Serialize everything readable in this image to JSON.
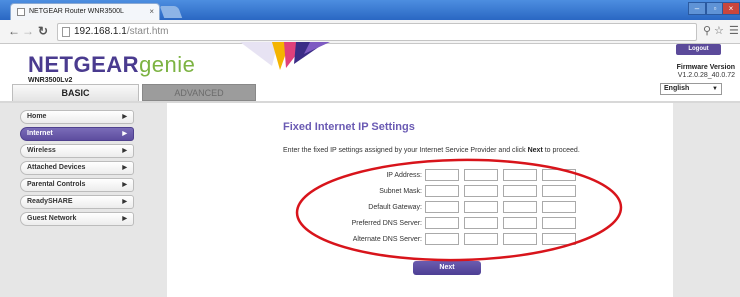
{
  "browser": {
    "tab_title": "NETGEAR Router WNR3500L",
    "tab_close": "×",
    "url_host": "192.168.1.1",
    "url_path": "/start.htm",
    "win_min": "–",
    "win_max": "▫",
    "win_close": "×"
  },
  "header": {
    "brand": "NETGEAR",
    "brand_suffix": "genie",
    "model": "WNR3500Lv2",
    "logout_label": "Logout",
    "firmware_label": "Firmware Version",
    "firmware_value": "V1.2.0.28_40.0.72",
    "language_value": "English"
  },
  "tabs": {
    "basic": "BASIC",
    "advanced": "ADVANCED"
  },
  "sidebar": {
    "items": [
      {
        "label": "Home",
        "active": false
      },
      {
        "label": "Internet",
        "active": true
      },
      {
        "label": "Wireless",
        "active": false
      },
      {
        "label": "Attached Devices",
        "active": false
      },
      {
        "label": "Parental Controls",
        "active": false
      },
      {
        "label": "ReadySHARE",
        "active": false
      },
      {
        "label": "Guest Network",
        "active": false
      }
    ]
  },
  "content": {
    "title": "Fixed Internet IP Settings",
    "desc_before": "Enter the fixed IP settings assigned by your Internet Service Provider and click ",
    "desc_bold": "Next",
    "desc_after": " to proceed.",
    "fields": [
      {
        "label": "IP Address:"
      },
      {
        "label": "Subnet Mask:"
      },
      {
        "label": "Default Gateway:"
      },
      {
        "label": "Preferred DNS Server:"
      },
      {
        "label": "Alternate DNS Server:"
      }
    ],
    "next_label": "Next"
  },
  "colors": {
    "accent_purple": "#5d4d9f",
    "title_purple": "#6a5ab3",
    "brand_green": "#7cb342",
    "annotation_red": "#d8141b"
  }
}
